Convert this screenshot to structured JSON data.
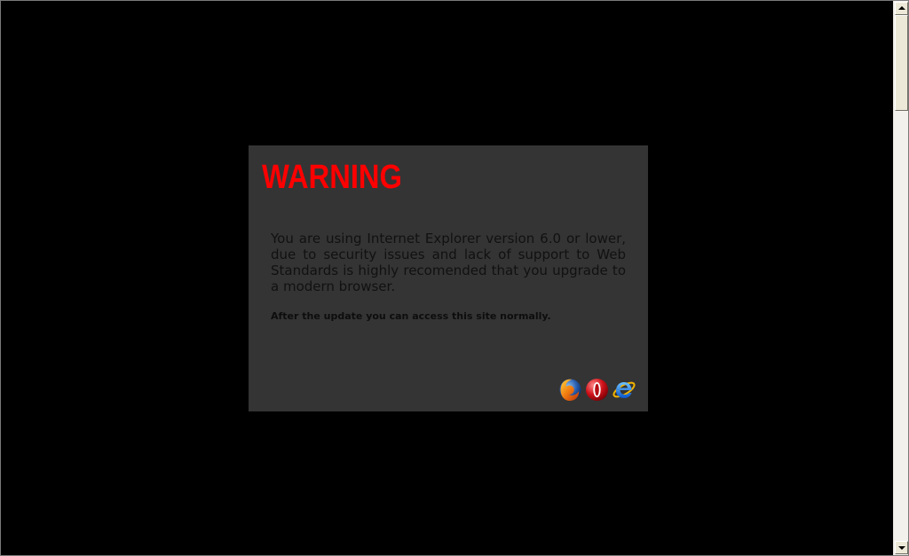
{
  "warning": {
    "title": "WARNING",
    "message": "You are using Internet Explorer version 6.0 or lower, due to security issues and lack of support to Web Standards is highly recomended that you upgrade to a modern browser.",
    "note": "After the update you can access this site normally."
  },
  "browsers": [
    {
      "icon": "firefox-icon"
    },
    {
      "icon": "opera-icon"
    },
    {
      "icon": "internet-explorer-icon"
    }
  ],
  "colors": {
    "page_background": "#000000",
    "box_background": "#343434",
    "title": "#ff0000",
    "text": "#111111"
  },
  "scrollbar": {
    "position_fraction": 0.0
  }
}
